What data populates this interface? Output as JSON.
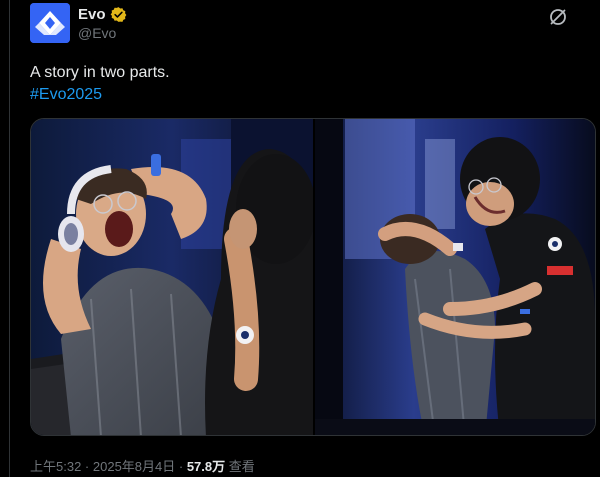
{
  "author": {
    "display_name": "Evo",
    "handle": "@Evo",
    "verified": true,
    "brand_color": "#3464f4",
    "verified_color": "#e2b719"
  },
  "tweet": {
    "text": "A story in two parts.",
    "hashtag": "#Evo2025",
    "hashtag_color": "#1d9bf0"
  },
  "media": {
    "photos": [
      {
        "name": "photo-left"
      },
      {
        "name": "photo-right"
      }
    ]
  },
  "meta": {
    "time": "上午5:32",
    "separator": " · ",
    "date": "2025年8月4日",
    "views": "57.8万",
    "views_label": "查看"
  },
  "icons": {
    "grok": "grok-icon",
    "verified": "verified-badge-icon"
  }
}
